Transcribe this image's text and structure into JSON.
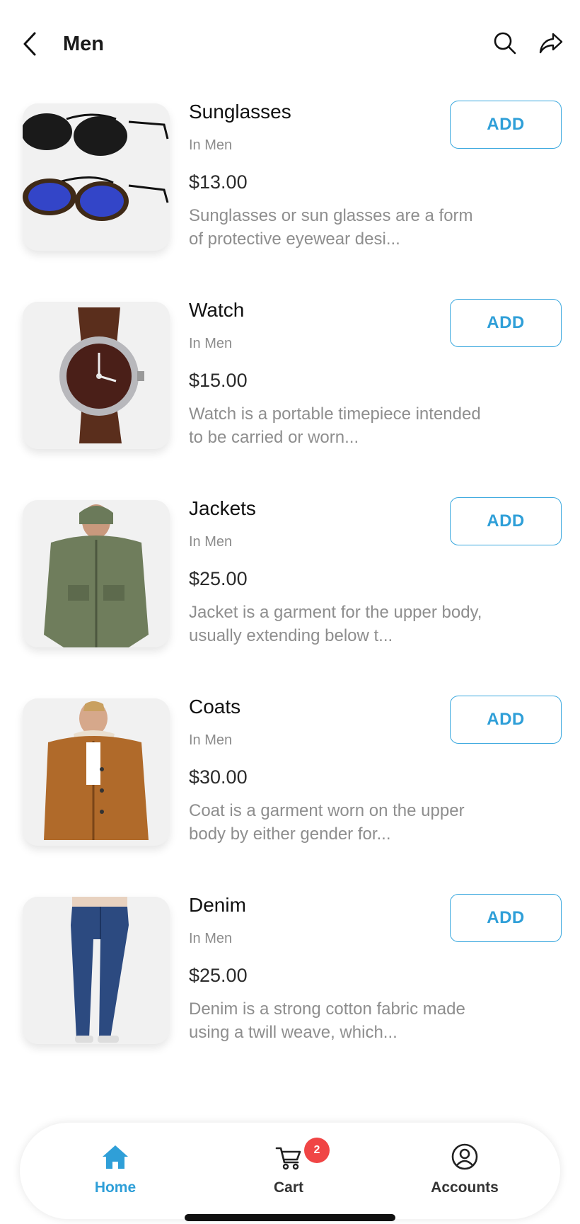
{
  "header": {
    "title": "Men",
    "back_icon": "chevron-left-icon",
    "search_icon": "search-icon",
    "share_icon": "share-icon"
  },
  "colors": {
    "accent": "#2f9fd8",
    "badge": "#f04545",
    "muted_text": "#8e8e8e"
  },
  "products": [
    {
      "name": "Sunglasses",
      "category": "In Men",
      "price": "$13.00",
      "description": "Sunglasses or sun glasses are a form of protective eyewear desi...",
      "add_label": "ADD"
    },
    {
      "name": "Watch",
      "category": "In Men",
      "price": "$15.00",
      "description": "Watch is a portable timepiece intended to be carried or worn...",
      "add_label": "ADD"
    },
    {
      "name": "Jackets",
      "category": "In Men",
      "price": "$25.00",
      "description": "Jacket is a garment for the upper body, usually extending below t...",
      "add_label": "ADD"
    },
    {
      "name": "Coats",
      "category": "In Men",
      "price": "$30.00",
      "description": "Coat is a garment worn on the upper body by either gender for...",
      "add_label": "ADD"
    },
    {
      "name": "Denim",
      "category": "In Men",
      "price": "$25.00",
      "description": "Denim is a strong cotton fabric made using a twill weave, which...",
      "add_label": "ADD"
    }
  ],
  "tabbar": {
    "home": {
      "label": "Home",
      "icon": "home-icon",
      "active": true
    },
    "cart": {
      "label": "Cart",
      "icon": "cart-icon",
      "badge": "2"
    },
    "accounts": {
      "label": "Accounts",
      "icon": "account-icon"
    }
  }
}
